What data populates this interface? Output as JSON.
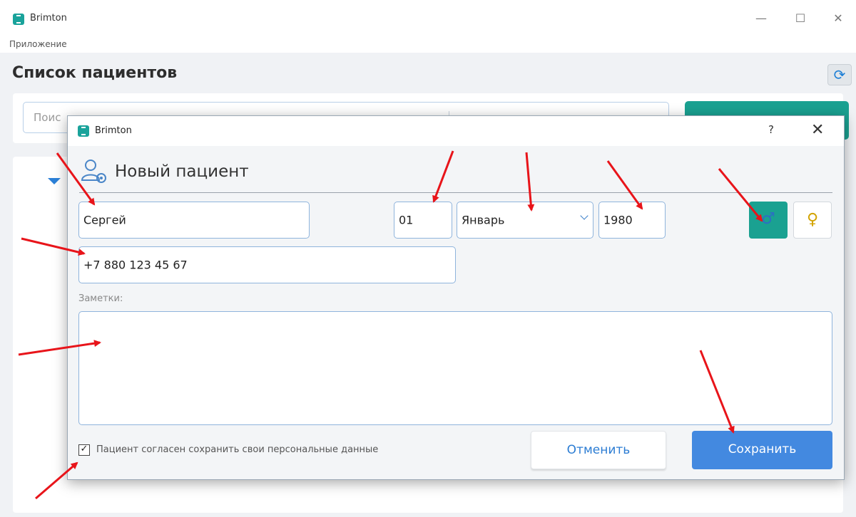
{
  "window": {
    "title": "Brimton",
    "menu": [
      "Приложение"
    ]
  },
  "page": {
    "title": "Список пациентов",
    "search_placeholder": "Поис"
  },
  "dialog": {
    "title": "Brimton",
    "help": "?",
    "close": "✕",
    "heading": "Новый пациент",
    "header_icon": "user-settings-icon",
    "first_name": "Сергей",
    "birth_day": "01",
    "birth_month": "Январь",
    "birth_year": "1980",
    "phone": "+7 880 123 45 67",
    "notes_label": "Заметки:",
    "notes_value": "",
    "gender_male_icon": "male-icon",
    "gender_female_icon": "female-icon",
    "consent_checked": true,
    "consent_label": "Пациент согласен сохранить свои персональные данные",
    "cancel_label": "Отменить",
    "save_label": "Сохранить"
  },
  "colors": {
    "teal": "#1aa191",
    "blue": "#4389e0",
    "arrow": "#e8141a",
    "border": "#8fb4dc"
  }
}
